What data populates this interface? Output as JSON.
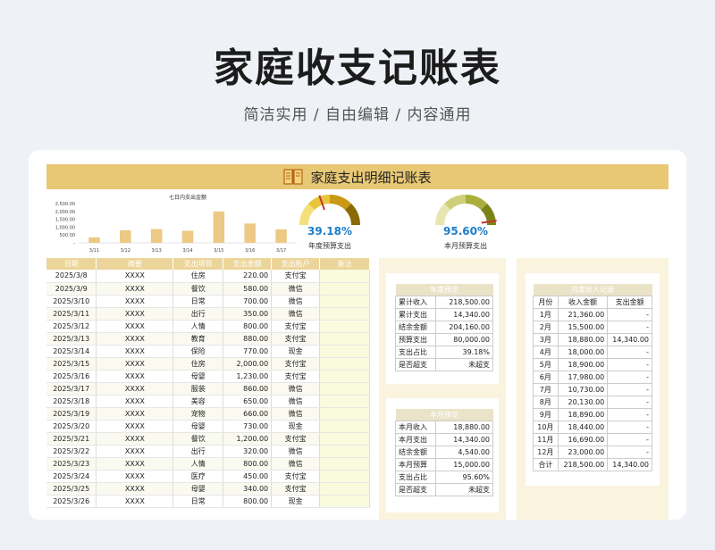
{
  "page": {
    "title": "家庭收支记账表",
    "subtitle": "简洁实用 / 自由编辑 / 内容通用"
  },
  "sheet": {
    "title": "家庭支出明细记账表"
  },
  "chart_data": {
    "type": "bar",
    "title": "七日内支出金额",
    "categories": [
      "3/11",
      "3/12",
      "3/13",
      "3/14",
      "3/15",
      "3/16",
      "3/17"
    ],
    "values": [
      350,
      800,
      880,
      770,
      2000,
      1230,
      860
    ],
    "ylim": [
      0,
      2500
    ],
    "yticks": [
      "2,500.00",
      "2,000.00",
      "1,500.00",
      "1,000.00",
      "500.00",
      "-"
    ],
    "color": "#ecca85"
  },
  "gauges": [
    {
      "value_label": "39.18%",
      "fraction": 0.3918,
      "label": "年度预算支出",
      "track_colors": [
        "#f3e07a",
        "#e8c53a",
        "#c99a14",
        "#8a6a05"
      ],
      "needle": "#c0392b"
    },
    {
      "value_label": "95.60%",
      "fraction": 0.956,
      "label": "本月预算支出",
      "track_colors": [
        "#e8e6b0",
        "#cfcf7a",
        "#a9ae3d",
        "#7a8416"
      ],
      "needle": "#c0392b"
    }
  ],
  "table": {
    "headers": [
      "日期",
      "摘要",
      "支出项目",
      "支出金额",
      "支出账户",
      "备注"
    ],
    "rows": [
      [
        "2025/3/8",
        "XXXX",
        "住房",
        "220.00",
        "支付宝",
        ""
      ],
      [
        "2025/3/9",
        "XXXX",
        "餐饮",
        "580.00",
        "微信",
        ""
      ],
      [
        "2025/3/10",
        "XXXX",
        "日常",
        "700.00",
        "微信",
        ""
      ],
      [
        "2025/3/11",
        "XXXX",
        "出行",
        "350.00",
        "微信",
        ""
      ],
      [
        "2025/3/12",
        "XXXX",
        "人情",
        "800.00",
        "支付宝",
        ""
      ],
      [
        "2025/3/13",
        "XXXX",
        "教育",
        "880.00",
        "支付宝",
        ""
      ],
      [
        "2025/3/14",
        "XXXX",
        "保险",
        "770.00",
        "现金",
        ""
      ],
      [
        "2025/3/15",
        "XXXX",
        "住房",
        "2,000.00",
        "支付宝",
        ""
      ],
      [
        "2025/3/16",
        "XXXX",
        "母婴",
        "1,230.00",
        "支付宝",
        ""
      ],
      [
        "2025/3/17",
        "XXXX",
        "服装",
        "860.00",
        "微信",
        ""
      ],
      [
        "2025/3/18",
        "XXXX",
        "美容",
        "650.00",
        "微信",
        ""
      ],
      [
        "2025/3/19",
        "XXXX",
        "宠物",
        "660.00",
        "微信",
        ""
      ],
      [
        "2025/3/20",
        "XXXX",
        "母婴",
        "730.00",
        "现金",
        ""
      ],
      [
        "2025/3/21",
        "XXXX",
        "餐饮",
        "1,200.00",
        "支付宝",
        ""
      ],
      [
        "2025/3/22",
        "XXXX",
        "出行",
        "320.00",
        "微信",
        ""
      ],
      [
        "2025/3/23",
        "XXXX",
        "人情",
        "800.00",
        "微信",
        ""
      ],
      [
        "2025/3/24",
        "XXXX",
        "医疗",
        "450.00",
        "支付宝",
        ""
      ],
      [
        "2025/3/25",
        "XXXX",
        "母婴",
        "340.00",
        "支付宝",
        ""
      ],
      [
        "2025/3/26",
        "XXXX",
        "日常",
        "800.00",
        "现金",
        ""
      ]
    ]
  },
  "annual": {
    "title": "年度预览",
    "rows": [
      [
        "累计收入",
        "218,500.00"
      ],
      [
        "累计支出",
        "14,340.00"
      ],
      [
        "结余金额",
        "204,160.00"
      ],
      [
        "预算支出",
        "80,000.00"
      ],
      [
        "支出占比",
        "39.18%"
      ],
      [
        "是否超支",
        "未超支"
      ]
    ]
  },
  "monthly": {
    "title": "本月预览",
    "rows": [
      [
        "本月收入",
        "18,880.00"
      ],
      [
        "本月支出",
        "14,340.00"
      ],
      [
        "结余金额",
        "4,540.00"
      ],
      [
        "本月预算",
        "15,000.00"
      ],
      [
        "支出占比",
        "95.60%"
      ],
      [
        "是否超支",
        "未超支"
      ]
    ]
  },
  "monthly_income": {
    "title": "月度收入记录",
    "headers": [
      "月份",
      "收入金额",
      "支出金额"
    ],
    "rows": [
      [
        "1月",
        "21,360.00",
        "-"
      ],
      [
        "2月",
        "15,500.00",
        "-"
      ],
      [
        "3月",
        "18,880.00",
        "14,340.00"
      ],
      [
        "4月",
        "18,000.00",
        "-"
      ],
      [
        "5月",
        "18,900.00",
        "-"
      ],
      [
        "6月",
        "17,980.00",
        "-"
      ],
      [
        "7月",
        "10,730.00",
        "-"
      ],
      [
        "8月",
        "20,130.00",
        "-"
      ],
      [
        "9月",
        "18,890.00",
        "-"
      ],
      [
        "10月",
        "18,440.00",
        "-"
      ],
      [
        "11月",
        "16,690.00",
        "-"
      ],
      [
        "12月",
        "23,000.00",
        "-"
      ],
      [
        "合计",
        "218,500.00",
        "14,340.00"
      ]
    ]
  }
}
